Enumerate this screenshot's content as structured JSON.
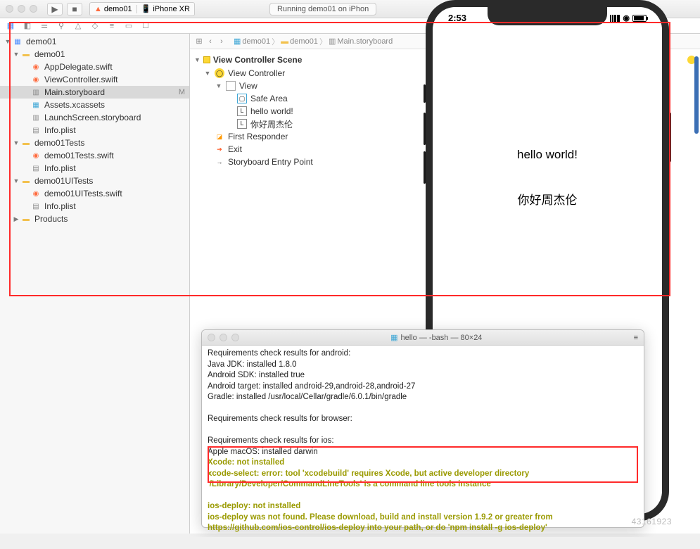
{
  "toolbar": {
    "scheme_project": "demo01",
    "scheme_device": "iPhone XR",
    "status_text": "Running demo01 on iPhon"
  },
  "navigator": {
    "items": [
      {
        "indent": 1,
        "type": "proj",
        "disc": "▼",
        "label": "demo01"
      },
      {
        "indent": 2,
        "type": "folder",
        "disc": "▼",
        "label": "demo01"
      },
      {
        "indent": 3,
        "type": "swift",
        "disc": "",
        "label": "AppDelegate.swift"
      },
      {
        "indent": 3,
        "type": "swift",
        "disc": "",
        "label": "ViewController.swift"
      },
      {
        "indent": 3,
        "type": "sb",
        "disc": "",
        "label": "Main.storyboard",
        "selected": true,
        "status": "M"
      },
      {
        "indent": 3,
        "type": "assets",
        "disc": "",
        "label": "Assets.xcassets"
      },
      {
        "indent": 3,
        "type": "sb",
        "disc": "",
        "label": "LaunchScreen.storyboard"
      },
      {
        "indent": 3,
        "type": "plist",
        "disc": "",
        "label": "Info.plist"
      },
      {
        "indent": 2,
        "type": "folder",
        "disc": "▼",
        "label": "demo01Tests"
      },
      {
        "indent": 3,
        "type": "swift",
        "disc": "",
        "label": "demo01Tests.swift"
      },
      {
        "indent": 3,
        "type": "plist",
        "disc": "",
        "label": "Info.plist"
      },
      {
        "indent": 2,
        "type": "folder",
        "disc": "▼",
        "label": "demo01UITests"
      },
      {
        "indent": 3,
        "type": "swift",
        "disc": "",
        "label": "demo01UITests.swift"
      },
      {
        "indent": 3,
        "type": "plist",
        "disc": "",
        "label": "Info.plist"
      },
      {
        "indent": 2,
        "type": "folder",
        "disc": "▶",
        "label": "Products"
      }
    ]
  },
  "breadcrumb": {
    "c1": "demo01",
    "c2": "demo01",
    "c3": "Main.storyboard"
  },
  "outline": {
    "scene": "View Controller Scene",
    "vc": "View Controller",
    "view": "View",
    "safe": "Safe Area",
    "label1": "hello world!",
    "label2": "你好周杰伦",
    "fr": "First Responder",
    "exit": "Exit",
    "entry": "Storyboard Entry Point"
  },
  "simulator": {
    "time": "2:53",
    "label1": "hello world!",
    "label2": "你好周杰伦"
  },
  "terminal": {
    "title": "hello — -bash — 80×24",
    "l1": "Requirements check results for android:",
    "l2": "Java JDK: installed 1.8.0",
    "l3": "Android SDK: installed true",
    "l4": "Android target: installed android-29,android-28,android-27",
    "l5": "Gradle: installed /usr/local/Cellar/gradle/6.0.1/bin/gradle",
    "l6": "",
    "l7": "Requirements check results for browser:",
    "l8": "",
    "l9": "Requirements check results for ios:",
    "l10": "Apple macOS: installed darwin",
    "y1": "Xcode: not installed",
    "y2": "xcode-select: error: tool 'xcodebuild' requires Xcode, but active developer directory '/Library/Developer/CommandLineTools' is a command line tools instance",
    "y3": "ios-deploy: not installed",
    "y4": "ios-deploy was not found. Please download, build and install version 1.9.2 or greater from https://github.com/ios-control/ios-deploy into your path, or do 'npm install -g ios-deploy'"
  },
  "watermark": "43161923"
}
